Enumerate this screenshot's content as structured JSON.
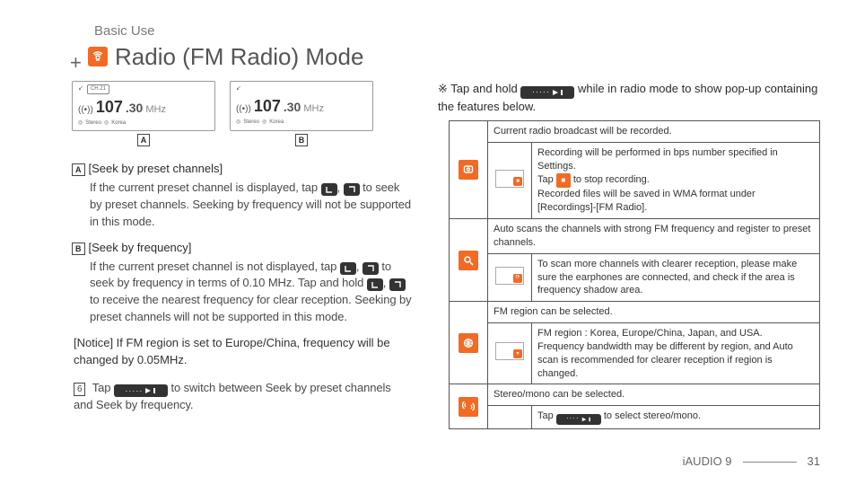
{
  "breadcrumb": "Basic Use",
  "title": "Radio (FM Radio) Mode",
  "screens": {
    "a_tag": "A",
    "b_tag": "B",
    "ch_badge": "CH.21",
    "freq_int": "107",
    "freq_frac": ".30",
    "freq_unit": "MHz",
    "stereo": "Stereo",
    "region": "Korea"
  },
  "sections": {
    "a_head": "[Seek by preset channels]",
    "a_body_1": "If the current preset channel is displayed, tap ",
    "a_body_2": " to seek by preset channels. Seeking by frequency will not be supported in this mode.",
    "b_head": "[Seek by frequency]",
    "b_body_1": "If the current preset channel is not displayed, tap ",
    "b_body_2": " to seek by frequency in terms of 0.10 MHz. Tap and hold ",
    "b_body_3": " to receive the nearest frequency for clear reception. Seeking by preset channels will not be supported in this mode.",
    "notice": "[Notice] If FM region is set to Europe/China, frequency will be changed by 0.05MHz.",
    "six_num": "6",
    "six_1": "Tap ",
    "six_2": " to switch between Seek by preset channels and Seek by frequency."
  },
  "right": {
    "intro_1": "Tap and hold ",
    "intro_2": " while in radio mode to show pop-up containing the features below.",
    "rec_head": "Current radio broadcast will be recorded.",
    "rec_body_1": "Recording will be performed in bps number specified in Settings.",
    "rec_body_2a": "Tap ",
    "rec_body_2b": " to stop recording.",
    "rec_body_3": "Recorded files will be saved in WMA format under [Recordings]-[FM Radio].",
    "scan_head": "Auto scans the channels with strong FM frequency and register to preset channels.",
    "scan_body": "To scan more channels with clearer reception, please make sure the earphones are connected, and check if the area is frequency shadow area.",
    "region_head": "FM region can be selected.",
    "region_body_1": "FM region : Korea, Europe/China, Japan, and USA.",
    "region_body_2": "Frequency bandwidth may be different by region, and Auto scan is recommended for clearer reception if region is changed.",
    "stereo_head": "Stereo/mono can be selected.",
    "stereo_body_a": "Tap ",
    "stereo_body_b": " to select stereo/mono."
  },
  "footer": {
    "product": "iAUDIO 9",
    "page": "31"
  }
}
